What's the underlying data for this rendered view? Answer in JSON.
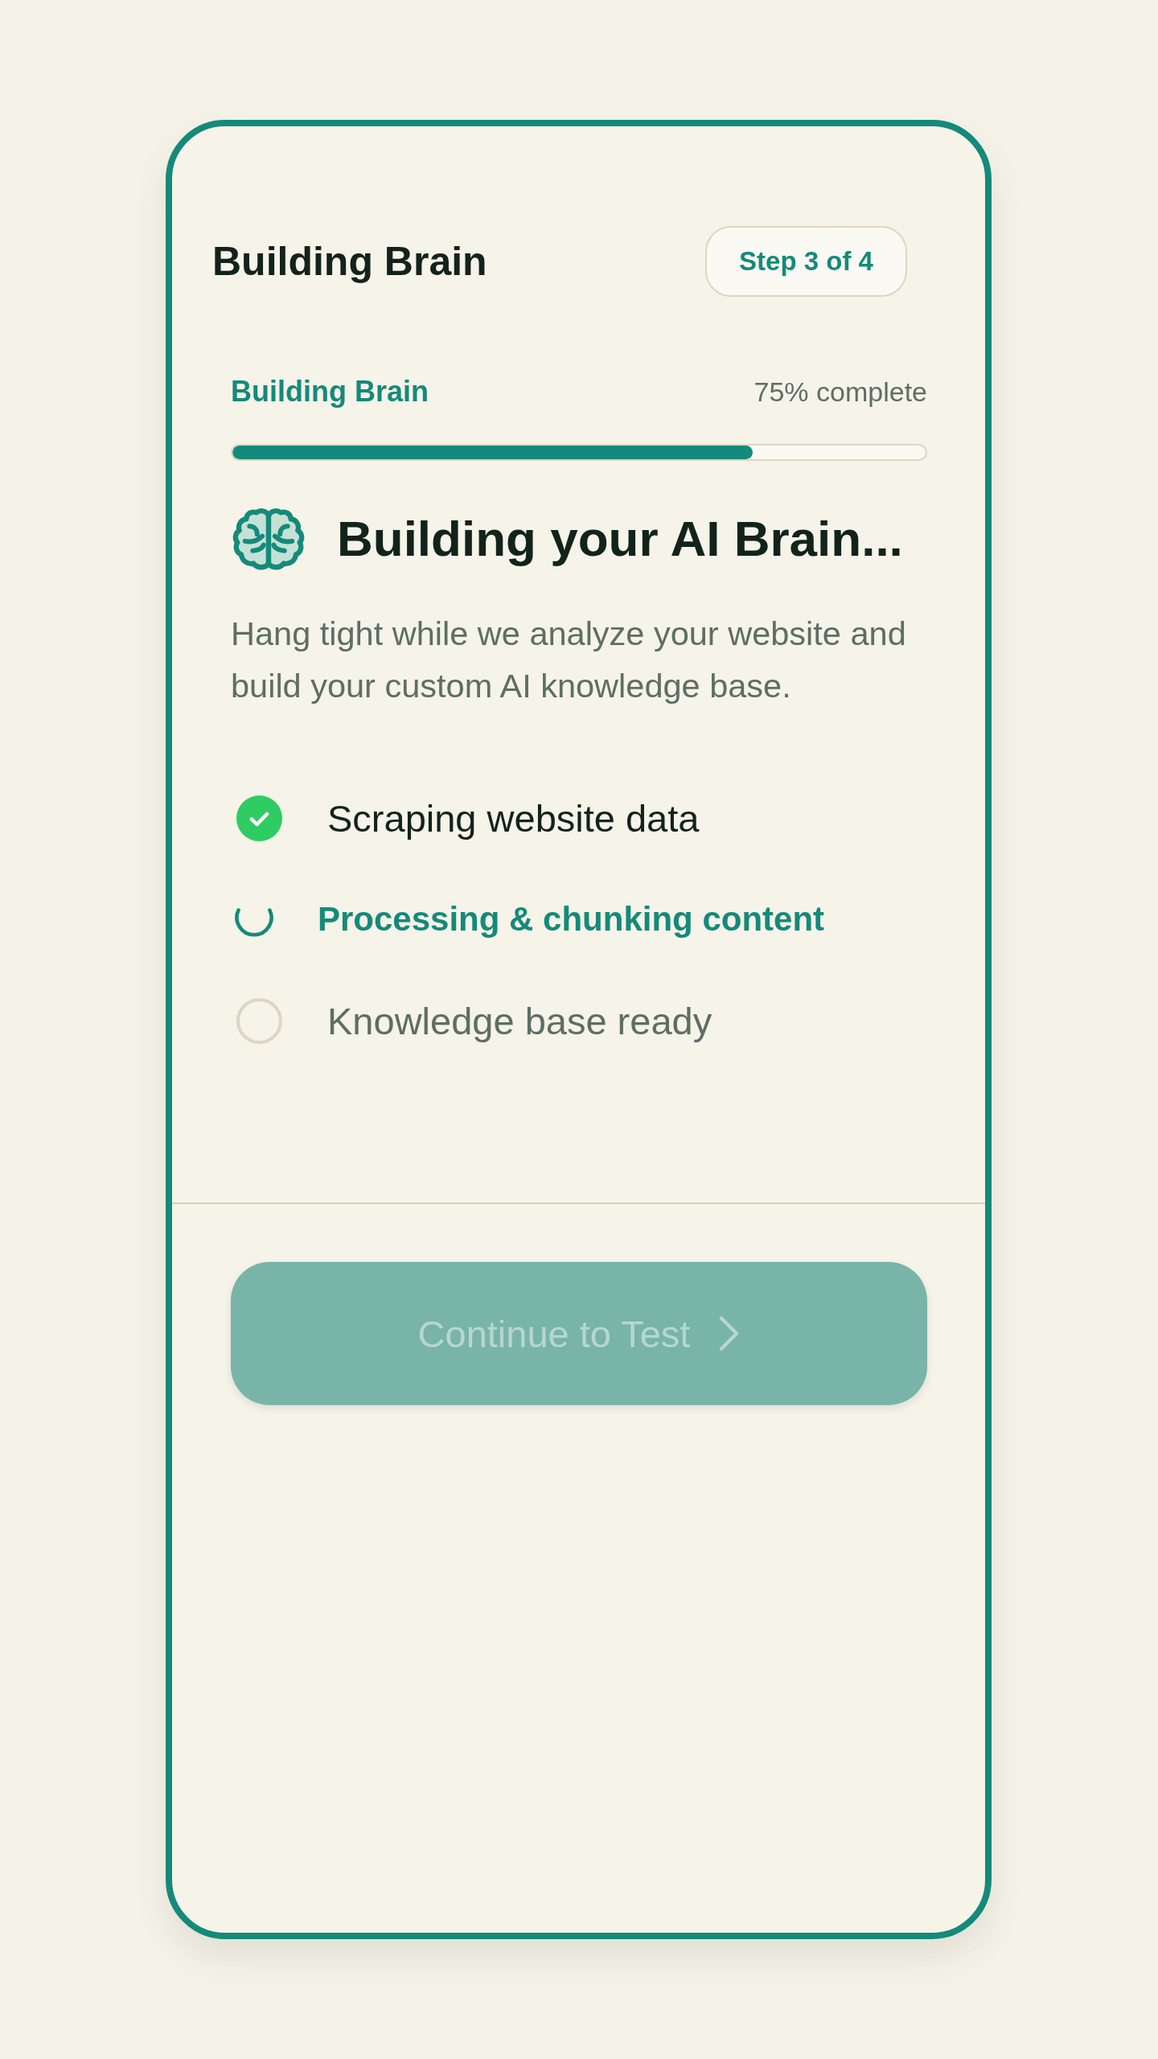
{
  "header": {
    "title": "Building Brain",
    "step_badge": "Step 3 of 4"
  },
  "progress": {
    "label": "Building Brain",
    "reading": "75% complete",
    "level": 0.75
  },
  "heading": "Building your AI Brain...",
  "description": "Hang tight while we analyze your website and build your custom AI knowledge base.",
  "steps": [
    {
      "label": "Scraping website data",
      "kind": "done"
    },
    {
      "label": "Processing & chunking content",
      "kind": "active"
    },
    {
      "label": "Knowledge base ready",
      "kind": "pending"
    }
  ],
  "continue_button": {
    "label": "Continue to Test",
    "disabled": true
  }
}
